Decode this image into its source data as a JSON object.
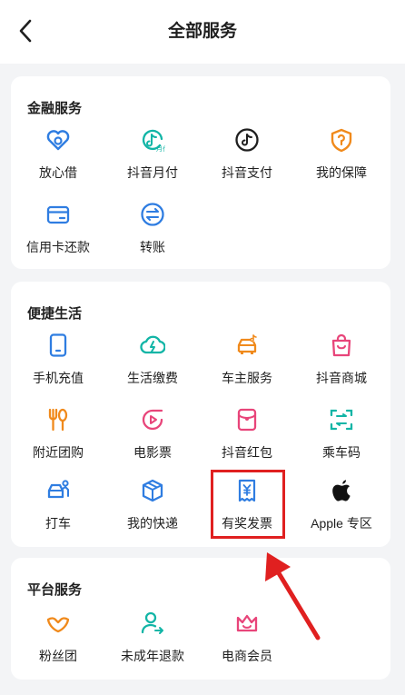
{
  "header": {
    "title": "全部服务",
    "back_label": "返回"
  },
  "sections": [
    {
      "title": "金融服务",
      "items": [
        {
          "label": "放心借",
          "icon": "loan-icon"
        },
        {
          "label": "抖音月付",
          "icon": "monthly-pay-icon"
        },
        {
          "label": "抖音支付",
          "icon": "douyin-pay-icon"
        },
        {
          "label": "我的保障",
          "icon": "insurance-shield-icon"
        },
        {
          "label": "信用卡还款",
          "icon": "credit-card-icon"
        },
        {
          "label": "转账",
          "icon": "transfer-icon"
        }
      ]
    },
    {
      "title": "便捷生活",
      "items": [
        {
          "label": "手机充值",
          "icon": "phone-topup-icon"
        },
        {
          "label": "生活缴费",
          "icon": "utility-bill-icon"
        },
        {
          "label": "车主服务",
          "icon": "car-service-icon"
        },
        {
          "label": "抖音商城",
          "icon": "shopping-bag-icon"
        },
        {
          "label": "附近团购",
          "icon": "fork-spoon-icon"
        },
        {
          "label": "电影票",
          "icon": "movie-ticket-icon"
        },
        {
          "label": "抖音红包",
          "icon": "red-envelope-icon"
        },
        {
          "label": "乘车码",
          "icon": "transit-scan-icon"
        },
        {
          "label": "打车",
          "icon": "taxi-icon"
        },
        {
          "label": "我的快递",
          "icon": "package-icon"
        },
        {
          "label": "有奖发票",
          "icon": "invoice-icon"
        },
        {
          "label": "Apple 专区",
          "icon": "apple-icon"
        }
      ]
    },
    {
      "title": "平台服务",
      "items": [
        {
          "label": "粉丝团",
          "icon": "fan-club-icon"
        },
        {
          "label": "未成年退款",
          "icon": "minor-refund-icon"
        },
        {
          "label": "电商会员",
          "icon": "ecommerce-member-icon"
        }
      ]
    }
  ],
  "colors": {
    "blue": "#2f7de1",
    "teal": "#12b5a6",
    "orange": "#f08a1c",
    "pink": "#e8457a",
    "highlight": "#e02020"
  }
}
